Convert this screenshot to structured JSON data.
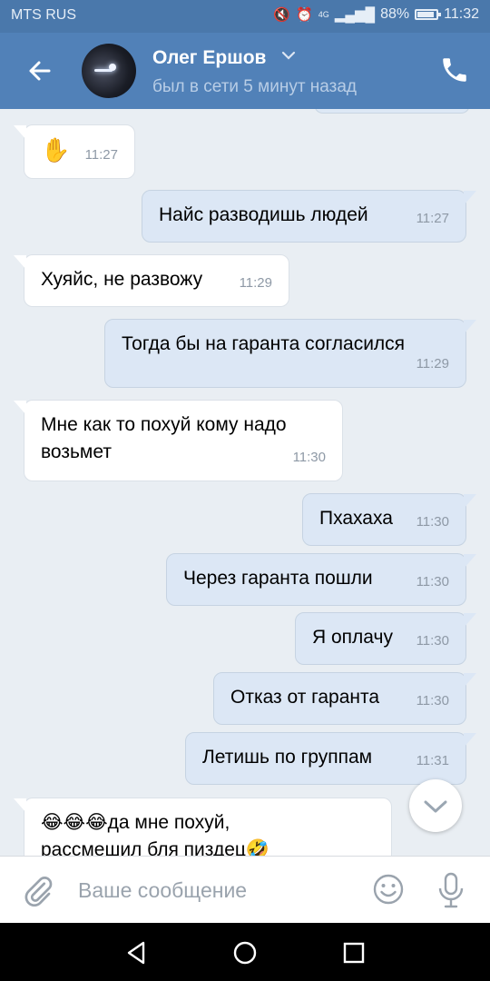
{
  "status": {
    "carrier": "MTS RUS",
    "battery": "88%",
    "time": "11:32",
    "network": "4G"
  },
  "contact": {
    "name": "Олег Ершов",
    "presence": "был в сети 5 минут назад"
  },
  "messages": [
    {
      "dir": "in",
      "lines": [
        "✋"
      ],
      "time": "11:27"
    },
    {
      "dir": "out",
      "lines": [
        "Найс разводишь людей"
      ],
      "time": "11:27"
    },
    {
      "dir": "in",
      "lines": [
        "Хуяйс, не развожу"
      ],
      "time": "11:29"
    },
    {
      "dir": "out",
      "lines": [
        "Тогда бы на гаранта согласился"
      ],
      "time": "11:29"
    },
    {
      "dir": "in",
      "lines": [
        "Мне как то похуй кому надо",
        "возьмет"
      ],
      "time": "11:30"
    },
    {
      "dir": "out",
      "lines": [
        "Пхахаха"
      ],
      "time": "11:30"
    },
    {
      "dir": "out",
      "lines": [
        "Через гаранта пошли"
      ],
      "time": "11:30"
    },
    {
      "dir": "out",
      "lines": [
        "Я оплачу"
      ],
      "time": "11:30"
    },
    {
      "dir": "out",
      "lines": [
        "Отказ от гаранта"
      ],
      "time": "11:30"
    },
    {
      "dir": "out",
      "lines": [
        "Летишь по группам"
      ],
      "time": "11:31"
    },
    {
      "dir": "in",
      "lines": [
        "😂😂😂да мне похуй,",
        "рассмешил бля пиздец🤣"
      ],
      "time": ""
    }
  ],
  "composer": {
    "placeholder": "Ваше сообщение"
  },
  "icons": {
    "back": "arrow-left-icon",
    "call": "phone-icon",
    "attach": "paperclip-icon",
    "emoji": "smile-icon",
    "mic": "microphone-icon",
    "scroll": "chevron-down-icon",
    "nav_back": "triangle-back-icon",
    "nav_home": "circle-home-icon",
    "nav_recent": "square-recent-icon"
  },
  "colors": {
    "header": "#5181b8",
    "statusbar": "#4a78ab",
    "outgoing": "#dce7f5",
    "incoming": "#ffffff",
    "background": "#e9eef3"
  }
}
